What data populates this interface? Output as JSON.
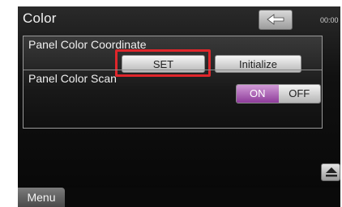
{
  "header": {
    "title": "Color",
    "clock": "00:00",
    "back_icon": "back-arrow-icon"
  },
  "panel": {
    "coordinate": {
      "label": "Panel Color Coordinate",
      "set_button": "SET",
      "initialize_button": "Initialize"
    },
    "scan": {
      "label": "Panel Color Scan",
      "on_label": "ON",
      "off_label": "OFF",
      "selected": "ON"
    }
  },
  "footer": {
    "menu_label": "Menu",
    "scroll_icon": "eject-icon"
  },
  "colors": {
    "highlight": "#e0262b",
    "toggle_on": "#8e3c9a"
  }
}
